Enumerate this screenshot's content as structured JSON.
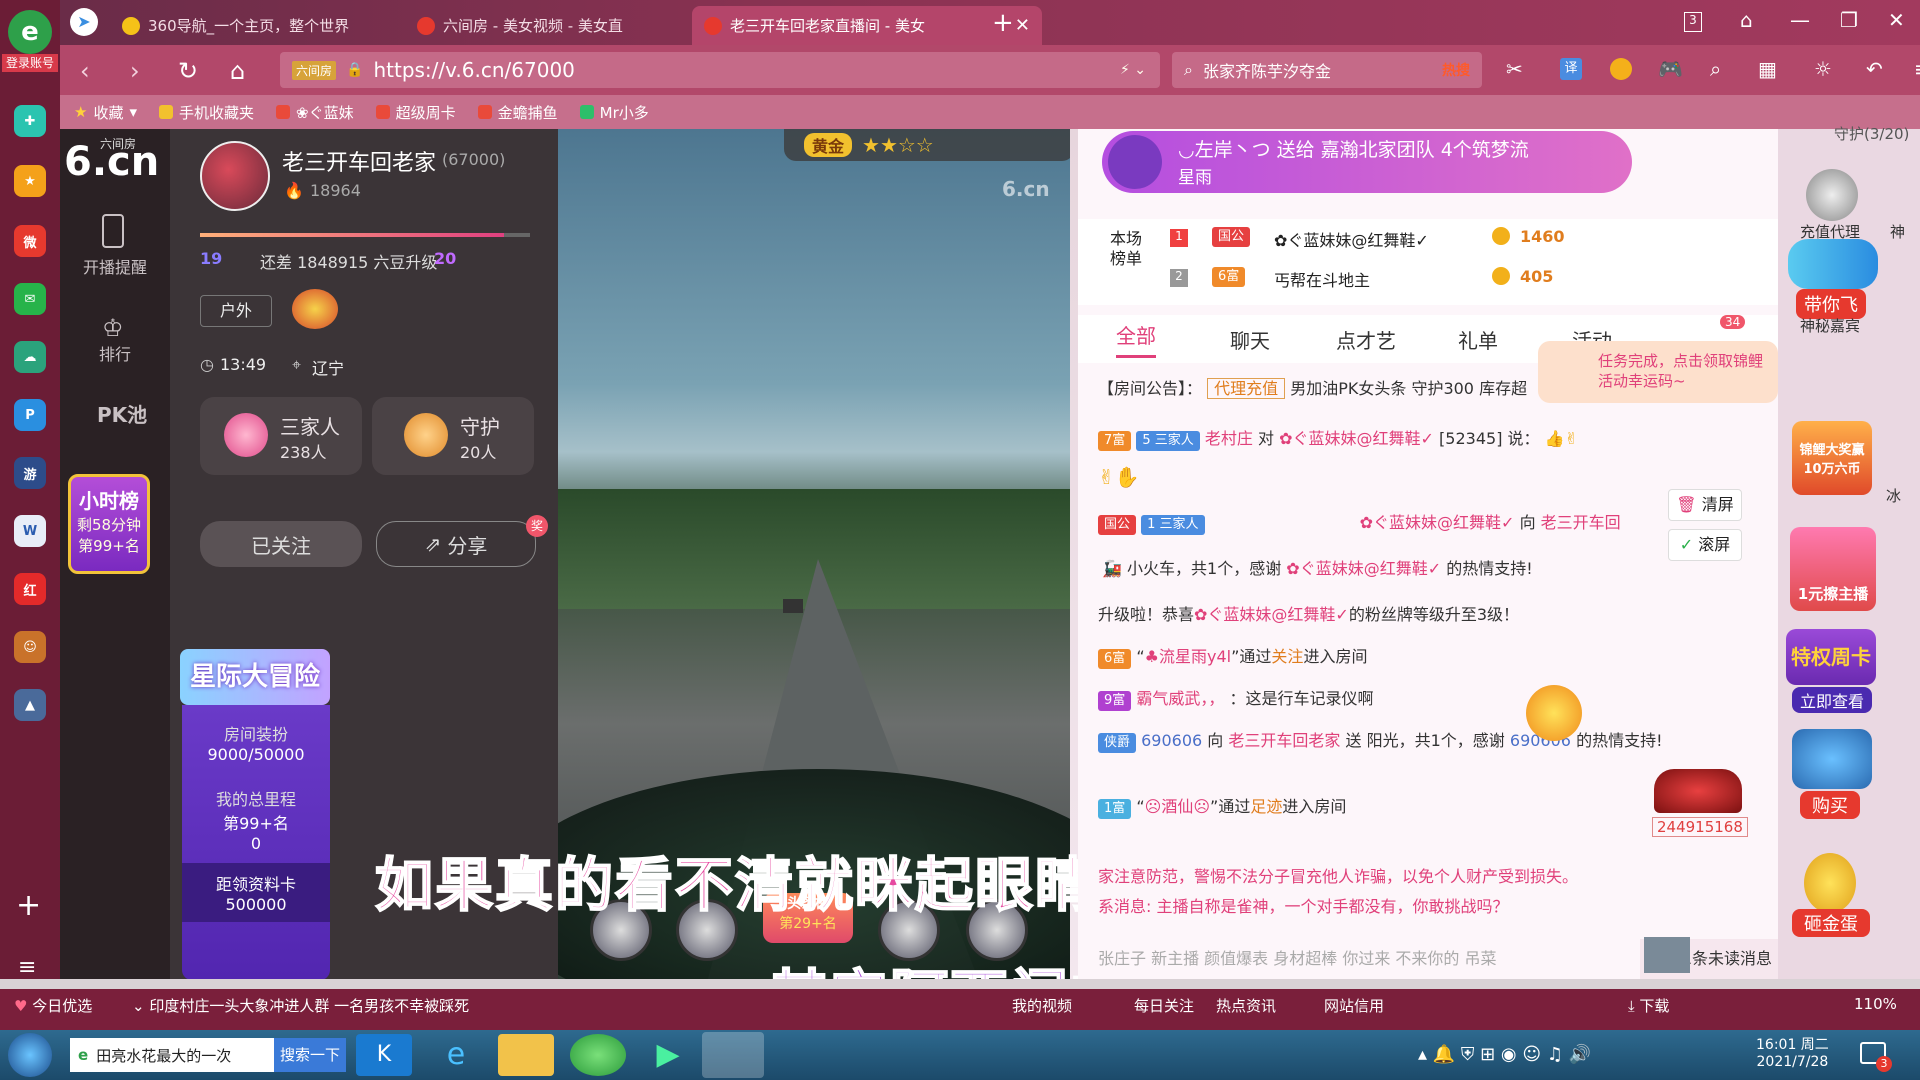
{
  "browser": {
    "tabs": [
      {
        "label": "360导航_一个主页，整个世界"
      },
      {
        "label": "六间房 - 美女视频 - 美女直"
      },
      {
        "label": "老三开车回老家直播间 - 美女"
      }
    ],
    "tab_count": "3",
    "url_site_label": "六间房",
    "url": "https://v.6.cn/67000",
    "search_text": "张家齐陈芋汐夺金",
    "search_hot": "热搜",
    "translate_label": "译",
    "bookmarks": [
      "收藏",
      "手机收藏夹",
      "❀ぐ蓝妹",
      "超级周卡",
      "金蟾捕鱼",
      "Mr小多"
    ],
    "login_label": "登录账号"
  },
  "site_nav": {
    "logo_cn": "六间房",
    "logo": "6.cn",
    "items": [
      {
        "label": "开播提醒"
      },
      {
        "label": "排行"
      },
      {
        "label": "PK池"
      }
    ],
    "hour_rank": {
      "title": "小时榜",
      "remaining": "剩58分钟",
      "rank": "第99+名"
    }
  },
  "streamer": {
    "name": "老三开车回老家",
    "room_id": "(67000)",
    "fans": "18964",
    "level_from": "19",
    "level_to": "20",
    "level_text": "还差 1848915 六豆升级",
    "tag": "户外",
    "time": "13:49",
    "location": "辽宁",
    "family": {
      "title": "三家人",
      "count": "238人"
    },
    "guard": {
      "title": "守护",
      "count": "20人"
    },
    "follow_label": "已关注",
    "share_label": "分享",
    "share_badge": "奖",
    "adventure": {
      "title": "星际大冒险",
      "decor_label": "房间装扮",
      "decor_value": "9000/50000",
      "mileage_label": "我的总里程",
      "mileage_rank": "第99+名",
      "mileage_value": "0",
      "card_label": "距领资料卡",
      "card_value": "500000"
    }
  },
  "video": {
    "rank_badge": "黄金",
    "watermark": "6.cn",
    "headline_badge": "头条榜",
    "headline_rank": "第29+名",
    "subtitle1": "如果真的看不清就眯起眼睛",
    "subtitle2": "其实阿西门的天也并不很蓝"
  },
  "chat": {
    "gift_banner": {
      "text": "◡左岸丶つ 送给 嘉瀚北家团队 4个筑梦流",
      "sub": "星雨"
    },
    "ranking_title": "本场榜单",
    "ranking": [
      {
        "rank": "1",
        "badge": "国公",
        "name": "✿ぐ蓝妹妹@红舞鞋✓",
        "score": "1460"
      },
      {
        "rank": "2",
        "badge": "6富",
        "name": "丐帮在斗地主",
        "score": "405"
      }
    ],
    "tabs": [
      "全部",
      "聊天",
      "点才艺",
      "礼单",
      "活动"
    ],
    "tab_badge": "34",
    "task_tip": "任务完成，点击领取锦鲤活动幸运码~",
    "notice_label": "【房间公告】：",
    "notice_tag": "代理充值",
    "notice_text": "男加油PK女头条 守护300 库存超",
    "messages": [
      {
        "badge": "7富",
        "level": "5",
        "group": "三家人",
        "user": "老村庄",
        "mid": "对",
        "target": "✿ぐ蓝妹妹@红舞鞋✓",
        "id": "[52345]",
        "tail": "说："
      },
      {
        "badge": "国公",
        "level": "1",
        "group": "三家人",
        "user": "✿ぐ蓝妹妹@红舞鞋✓",
        "mid": "向",
        "target": "老三开车回",
        "line2": "小火车，共1个，感谢",
        "thanks_user": "✿ぐ蓝妹妹@红舞鞋✓",
        "thanks_tail": "的热情支持!"
      },
      {
        "text": "升级啦！恭喜",
        "user": "✿ぐ蓝妹妹@红舞鞋✓",
        "tail": "的粉丝牌等级升至3级！"
      },
      {
        "badge": "6富",
        "pre": "“",
        "user": "♣流星雨y4l",
        "mid": "”通过",
        "via": "关注",
        "tail": "进入房间"
      },
      {
        "badge": "9富",
        "user": "霸气威武，，",
        "tail": "：这是行车记录仪啊"
      },
      {
        "badge": "侠爵",
        "user": "690606",
        "mid": "向",
        "target": "老三开车回老家",
        "send": "送",
        "gift": "阳光，共1个，感谢",
        "thanks_user": "690606",
        "thanks_tail": "的热情支持!"
      },
      {
        "badge": "1富",
        "pre": "“",
        "user": "☹酒仙☹",
        "mid": "”通过",
        "via": "足迹",
        "tail": "进入房间"
      }
    ],
    "car_number": "244915168",
    "clear_label": "清屏",
    "scroll_label": "滚屏",
    "warning1": "家注意防范，警惕不法分子冒充他人诈骗，以免个人财产受到损失。",
    "warning2": "系消息: 主播自称是雀神，一个对手都没有，你敢挑战吗？",
    "bottom_line": "张庄子 新主播 颜值爆表 身材超棒 你过来 不来你的 吊菜",
    "unread": "您有1条未读消息"
  },
  "right_col": {
    "guard_count": "守护(3/20)",
    "items": [
      "充值代理",
      "神",
      "带你飞",
      "神秘嘉宾",
      "锦鲤大奖赢10万六币",
      "1元擦主播",
      "特权周卡",
      "立即查看",
      "购买",
      "砸金蛋",
      "冰"
    ]
  },
  "statusbar": {
    "today": "今日优选",
    "news": "印度村庄一头大象冲进人群 一名男孩不幸被踩死",
    "my_video": "我的视频",
    "daily": "每日关注",
    "hot_news": "热点资讯",
    "credit": "网站信用",
    "download": "下载",
    "zoom": "110%"
  },
  "taskbar": {
    "search_app": "田亮水花最大的一次",
    "search_btn": "搜索一下",
    "time": "16:01 周二",
    "date": "2021/7/28",
    "notify_count": "3"
  }
}
